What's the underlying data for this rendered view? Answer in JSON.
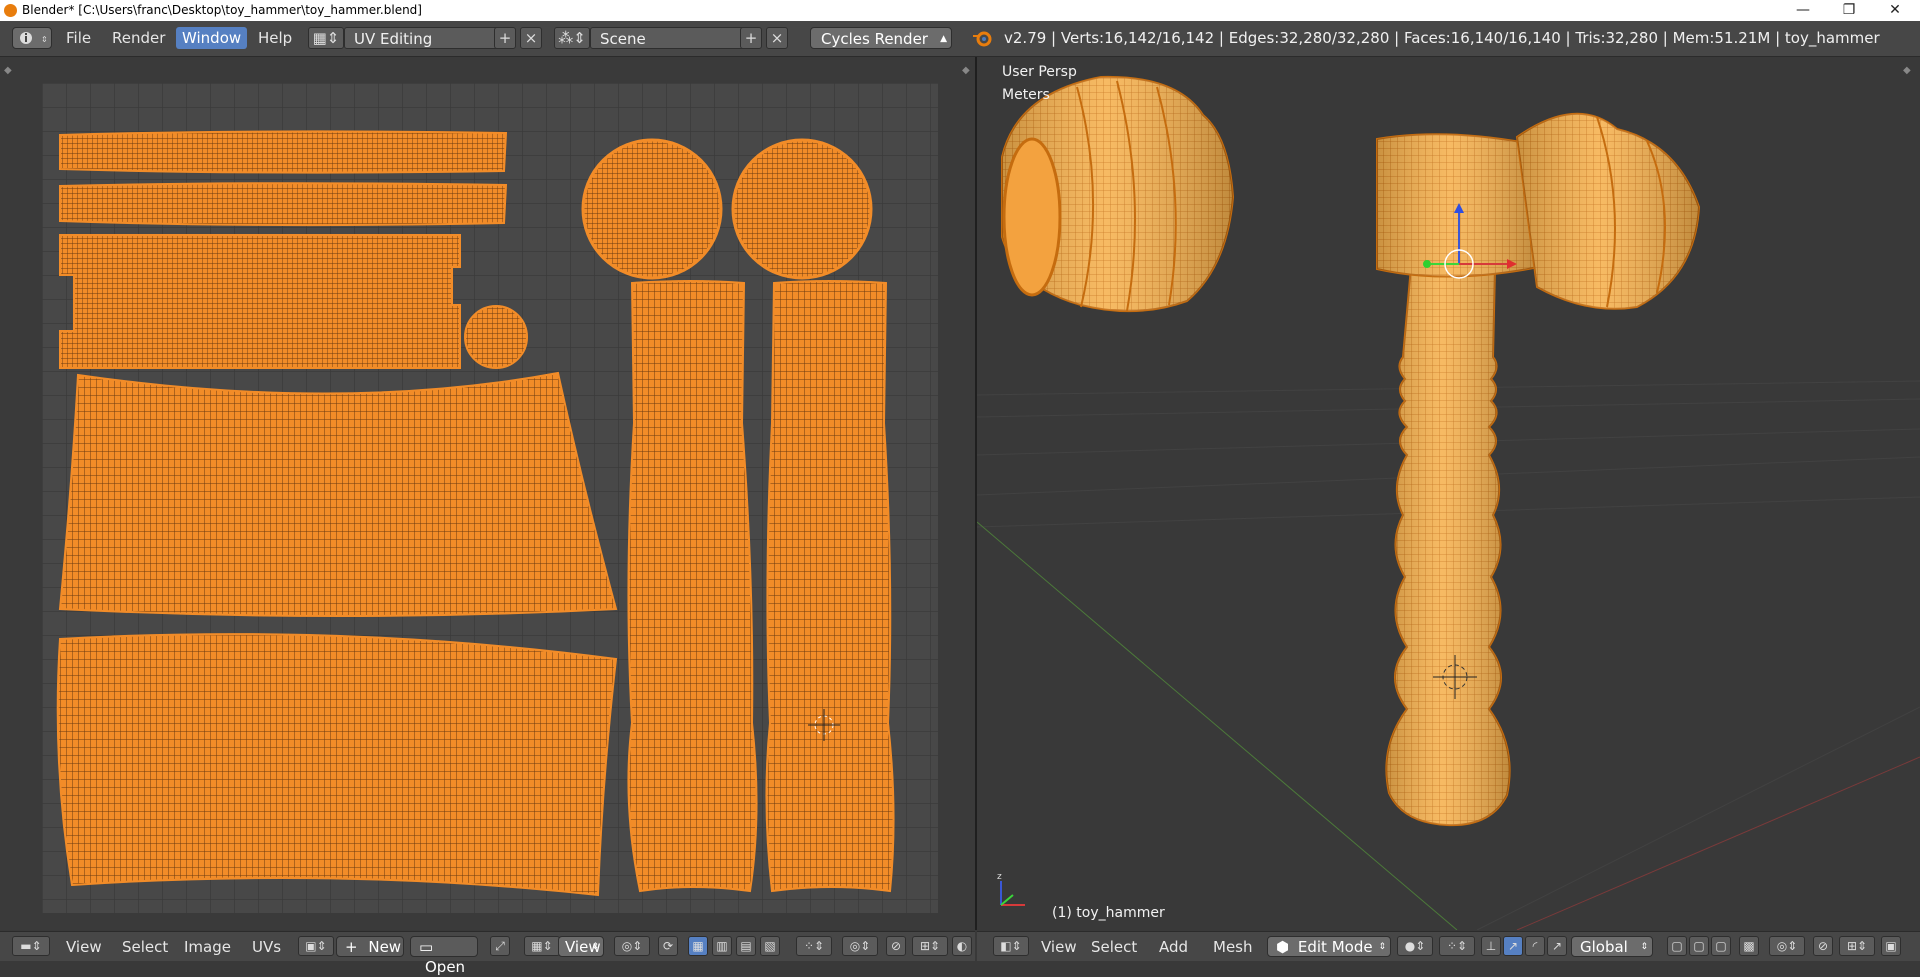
{
  "window": {
    "title": "Blender* [C:\\Users\\franc\\Desktop\\toy_hammer\\toy_hammer.blend]",
    "minimize": "—",
    "maximize": "❐",
    "close": "✕"
  },
  "topbar": {
    "menus": [
      "File",
      "Render",
      "Window",
      "Help"
    ],
    "active_menu": "Window",
    "screen_layout": "UV Editing",
    "scene": "Scene",
    "render_engine": "Cycles Render",
    "stats": "v2.79 | Verts:16,142/16,142 | Edges:32,280/32,280 | Faces:16,140/16,140 | Tris:32,280 | Mem:51.21M | toy_hammer"
  },
  "uv_editor": {
    "menus": [
      "View",
      "Select",
      "Image",
      "UVs"
    ],
    "new_label": "New",
    "open_label": "Open",
    "view_label": "View"
  },
  "viewport": {
    "view_name": "User Persp",
    "units": "Meters",
    "object_label": "(1) toy_hammer",
    "menus": [
      "View",
      "Select",
      "Add",
      "Mesh"
    ],
    "mode": "Edit Mode",
    "orientation": "Global"
  },
  "colors": {
    "uv_island": "#f28c28",
    "uv_wire": "#6b3a10",
    "selection_highlight": "#5680c2",
    "mesh_base": "#f6b14e",
    "mesh_wire": "#c56c0f"
  }
}
